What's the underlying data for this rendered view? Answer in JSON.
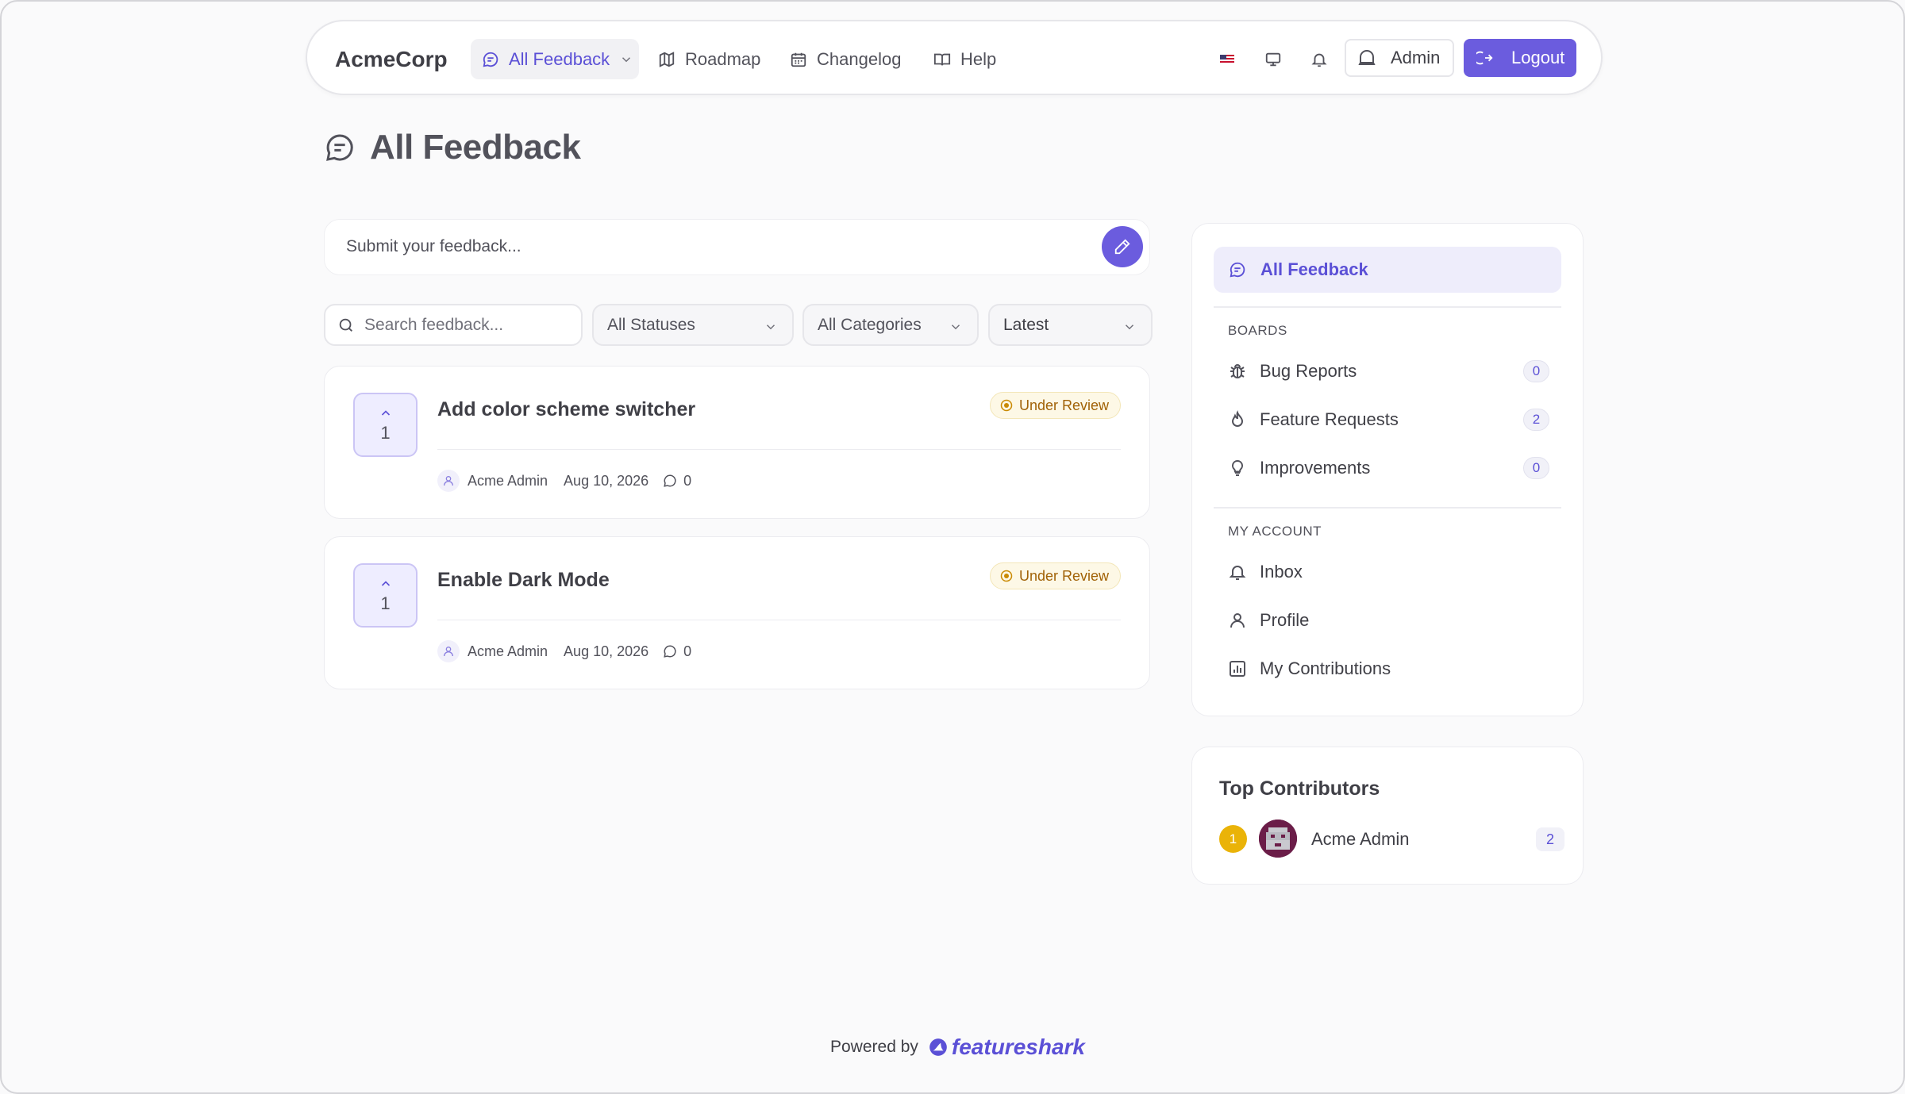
{
  "colors": {
    "accent": "#6b5cde",
    "status_under_review": "#a16207",
    "rank_gold": "#eab308"
  },
  "nav": {
    "brand": "AcmeCorp",
    "items": [
      {
        "label": "All Feedback",
        "icon": "chat-bubble-icon",
        "active": true
      },
      {
        "label": "Roadmap",
        "icon": "map-icon"
      },
      {
        "label": "Changelog",
        "icon": "calendar-icon"
      },
      {
        "label": "Help",
        "icon": "book-open-icon"
      }
    ],
    "admin_label": "Admin",
    "logout_label": "Logout"
  },
  "page": {
    "title": "All Feedback"
  },
  "submit": {
    "placeholder": "Submit your feedback..."
  },
  "filters": {
    "search_placeholder": "Search feedback...",
    "status": "All Statuses",
    "category": "All Categories",
    "sort": "Latest"
  },
  "feedback": [
    {
      "title": "Add color scheme switcher",
      "votes": "1",
      "status": "Under Review",
      "author": "Acme Admin",
      "date": "Aug 10, 2026",
      "comments": "0"
    },
    {
      "title": "Enable Dark Mode",
      "votes": "1",
      "status": "Under Review",
      "author": "Acme Admin",
      "date": "Aug 10, 2026",
      "comments": "0"
    }
  ],
  "sidebar": {
    "active_label": "All Feedback",
    "boards_heading": "BOARDS",
    "boards": [
      {
        "label": "Bug Reports",
        "count": "0",
        "icon": "bug-icon"
      },
      {
        "label": "Feature Requests",
        "count": "2",
        "icon": "flame-icon"
      },
      {
        "label": "Improvements",
        "count": "0",
        "icon": "lightbulb-icon"
      }
    ],
    "account_heading": "MY ACCOUNT",
    "account": [
      {
        "label": "Inbox",
        "icon": "bell-icon"
      },
      {
        "label": "Profile",
        "icon": "user-icon"
      },
      {
        "label": "My Contributions",
        "icon": "bar-chart-icon"
      }
    ]
  },
  "contributors": {
    "title": "Top Contributors",
    "list": [
      {
        "rank": "1",
        "name": "Acme Admin",
        "count": "2"
      }
    ]
  },
  "footer": {
    "powered_by": "Powered by",
    "brand": "featureshark"
  }
}
